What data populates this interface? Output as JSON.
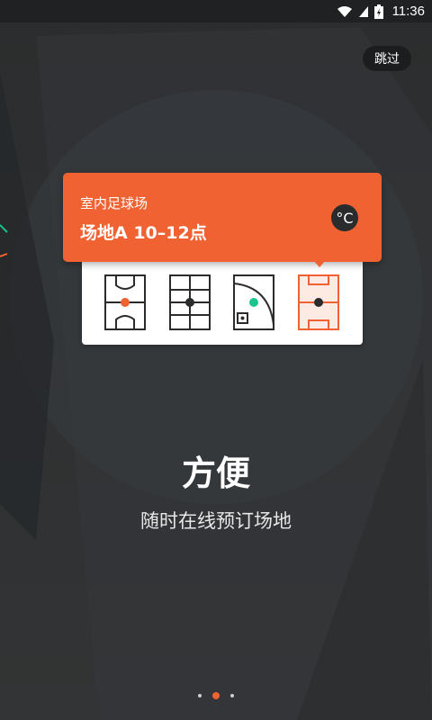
{
  "status_bar": {
    "time": "11:36"
  },
  "skip_label": "跳过",
  "booking": {
    "venue": "室内足球场",
    "slot": "场地A 10–12点",
    "weather_symbol": "°C"
  },
  "courts": [
    {
      "name": "basketball-court",
      "badge_color": "#f06231",
      "selected": false
    },
    {
      "name": "football-court",
      "badge_color": "#2a2b2c",
      "selected": false
    },
    {
      "name": "baseball-field",
      "badge_color": "#19c48e",
      "selected": false
    },
    {
      "name": "soccer-field",
      "badge_color": "#2a2b2c",
      "selected": true
    }
  ],
  "headline": "方便",
  "subheadline": "随时在线预订场地",
  "pager": {
    "count": 3,
    "active_index": 1
  },
  "colors": {
    "accent": "#f06231",
    "background": "#2e3031",
    "card": "#ffffff",
    "green": "#19c48e"
  }
}
